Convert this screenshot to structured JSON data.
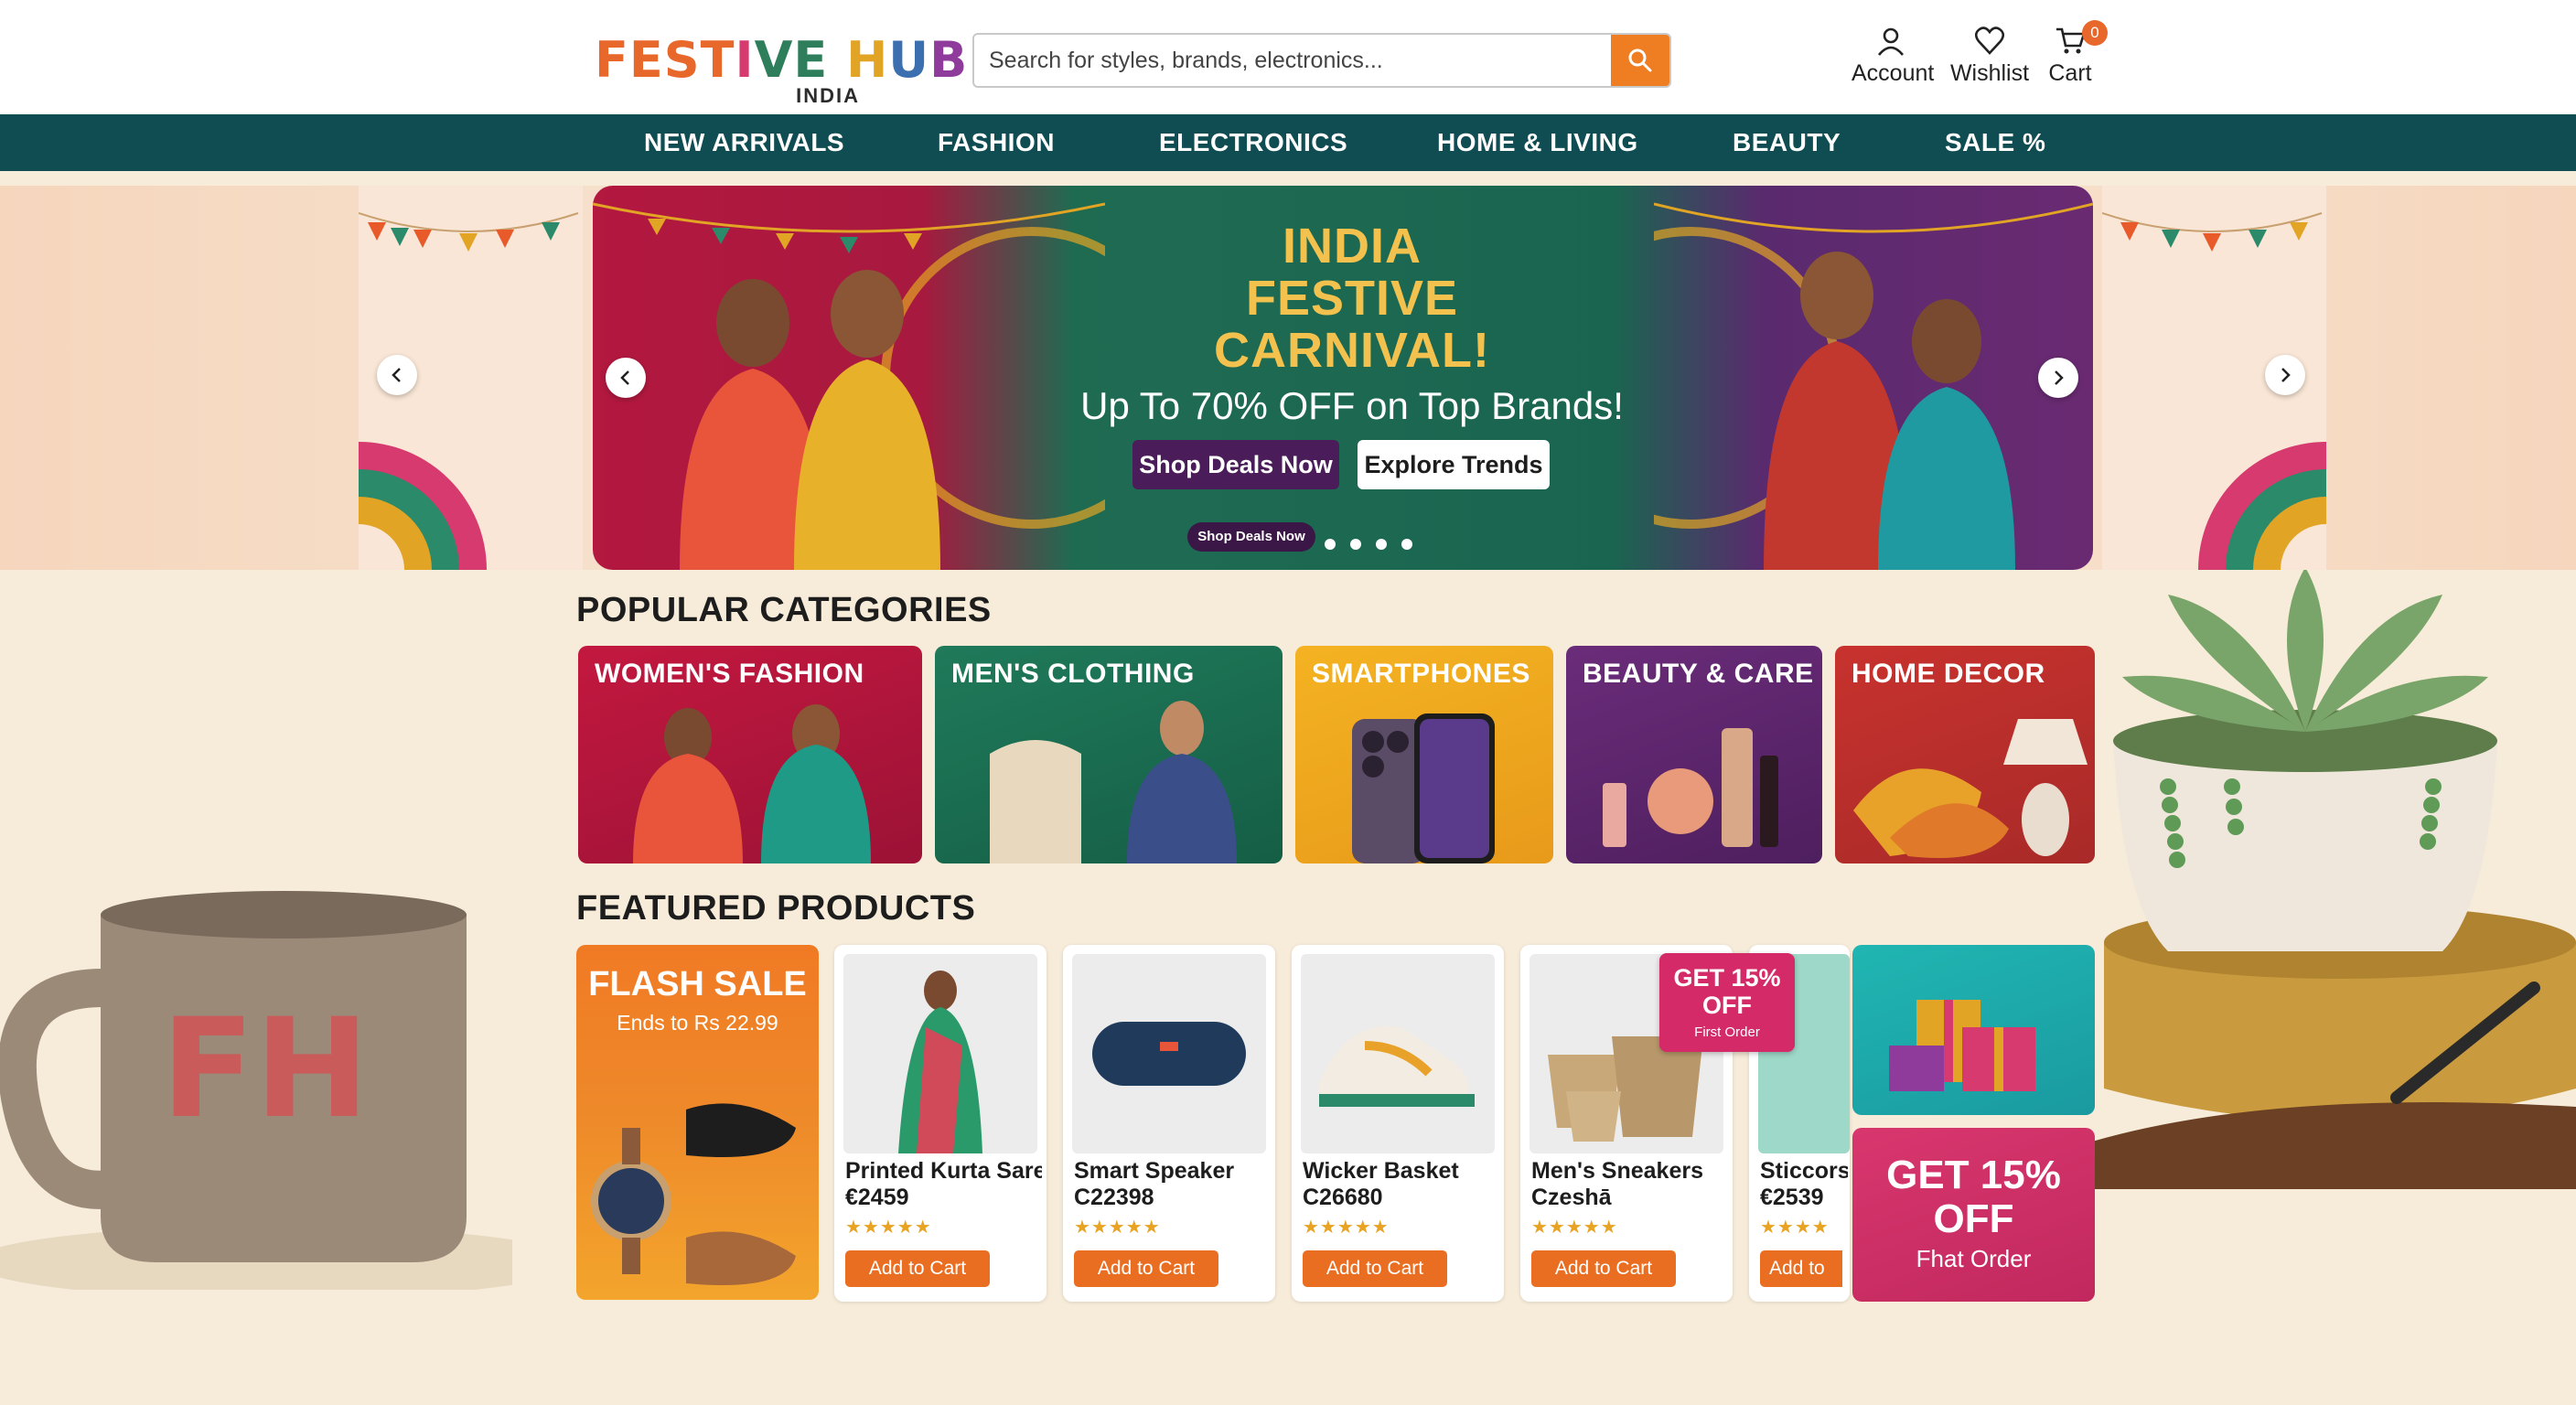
{
  "brand": {
    "logo_parts": [
      "FEST",
      "I",
      "VE ",
      "H",
      "U",
      "B"
    ],
    "logo_sub": "INDIA"
  },
  "search": {
    "placeholder": "Search for styles, brands, electronics..."
  },
  "header_actions": {
    "account": "Account",
    "wishlist": "Wishlist",
    "cart": "Cart",
    "cart_count": "0"
  },
  "nav": {
    "items": [
      "NEW ARRIVALS",
      "FASHION",
      "ELECTRONICS",
      "HOME & LIVING",
      "BEAUTY",
      "SALE %"
    ]
  },
  "hero": {
    "title_lines": [
      "INDIA",
      "FESTIVE",
      "CARNIVAL!"
    ],
    "subtitle": "Up To 70% OFF on Top Brands!",
    "primary_button": "Shop Deals Now",
    "secondary_button": "Explore Trends",
    "mini_label": "Shop Deals Now"
  },
  "categories": {
    "title": "POPULAR CATEGORIES",
    "items": [
      {
        "label": "WOMEN'S FASHION"
      },
      {
        "label": "MEN'S CLOTHING"
      },
      {
        "label": "SMARTPHONES"
      },
      {
        "label": "BEAUTY & CARE"
      },
      {
        "label": "HOME DECOR"
      }
    ]
  },
  "featured": {
    "title": "FEATURED PRODUCTS",
    "flash": {
      "title": "FLASH SALE",
      "subtitle": "Ends to Rs 22.99"
    },
    "products": [
      {
        "name": "Printed Kurta Saree",
        "price": "€2459",
        "stars": "★★★★★",
        "button": "Add to Cart"
      },
      {
        "name": "Smart Speaker",
        "price": "C22398",
        "stars": "★★★★★",
        "button": "Add to Cart"
      },
      {
        "name": "Wicker Basket",
        "price": "C26680",
        "stars": "★★★★★",
        "button": "Add to Cart"
      },
      {
        "name": "Men's Sneakers",
        "price": "Czeshā",
        "stars": "★★★★★",
        "button": "Add to Cart"
      },
      {
        "name": "Sticcors",
        "price": "€2539",
        "stars": "★★★★",
        "button": "Add to"
      }
    ],
    "promo_badge": {
      "line1": "GET 15%",
      "line2": "OFF",
      "line3": "First Order"
    },
    "offer_card": {
      "line1": "GET 15%",
      "line2": "OFF",
      "line3": "Fhat Order"
    }
  },
  "decor": {
    "mug_text": "FH"
  },
  "colors": {
    "nav_bg": "#0f4d52",
    "accent_orange": "#ea6e22",
    "hero_gold": "#f2c14e",
    "page_bg": "#f7ecd9"
  }
}
